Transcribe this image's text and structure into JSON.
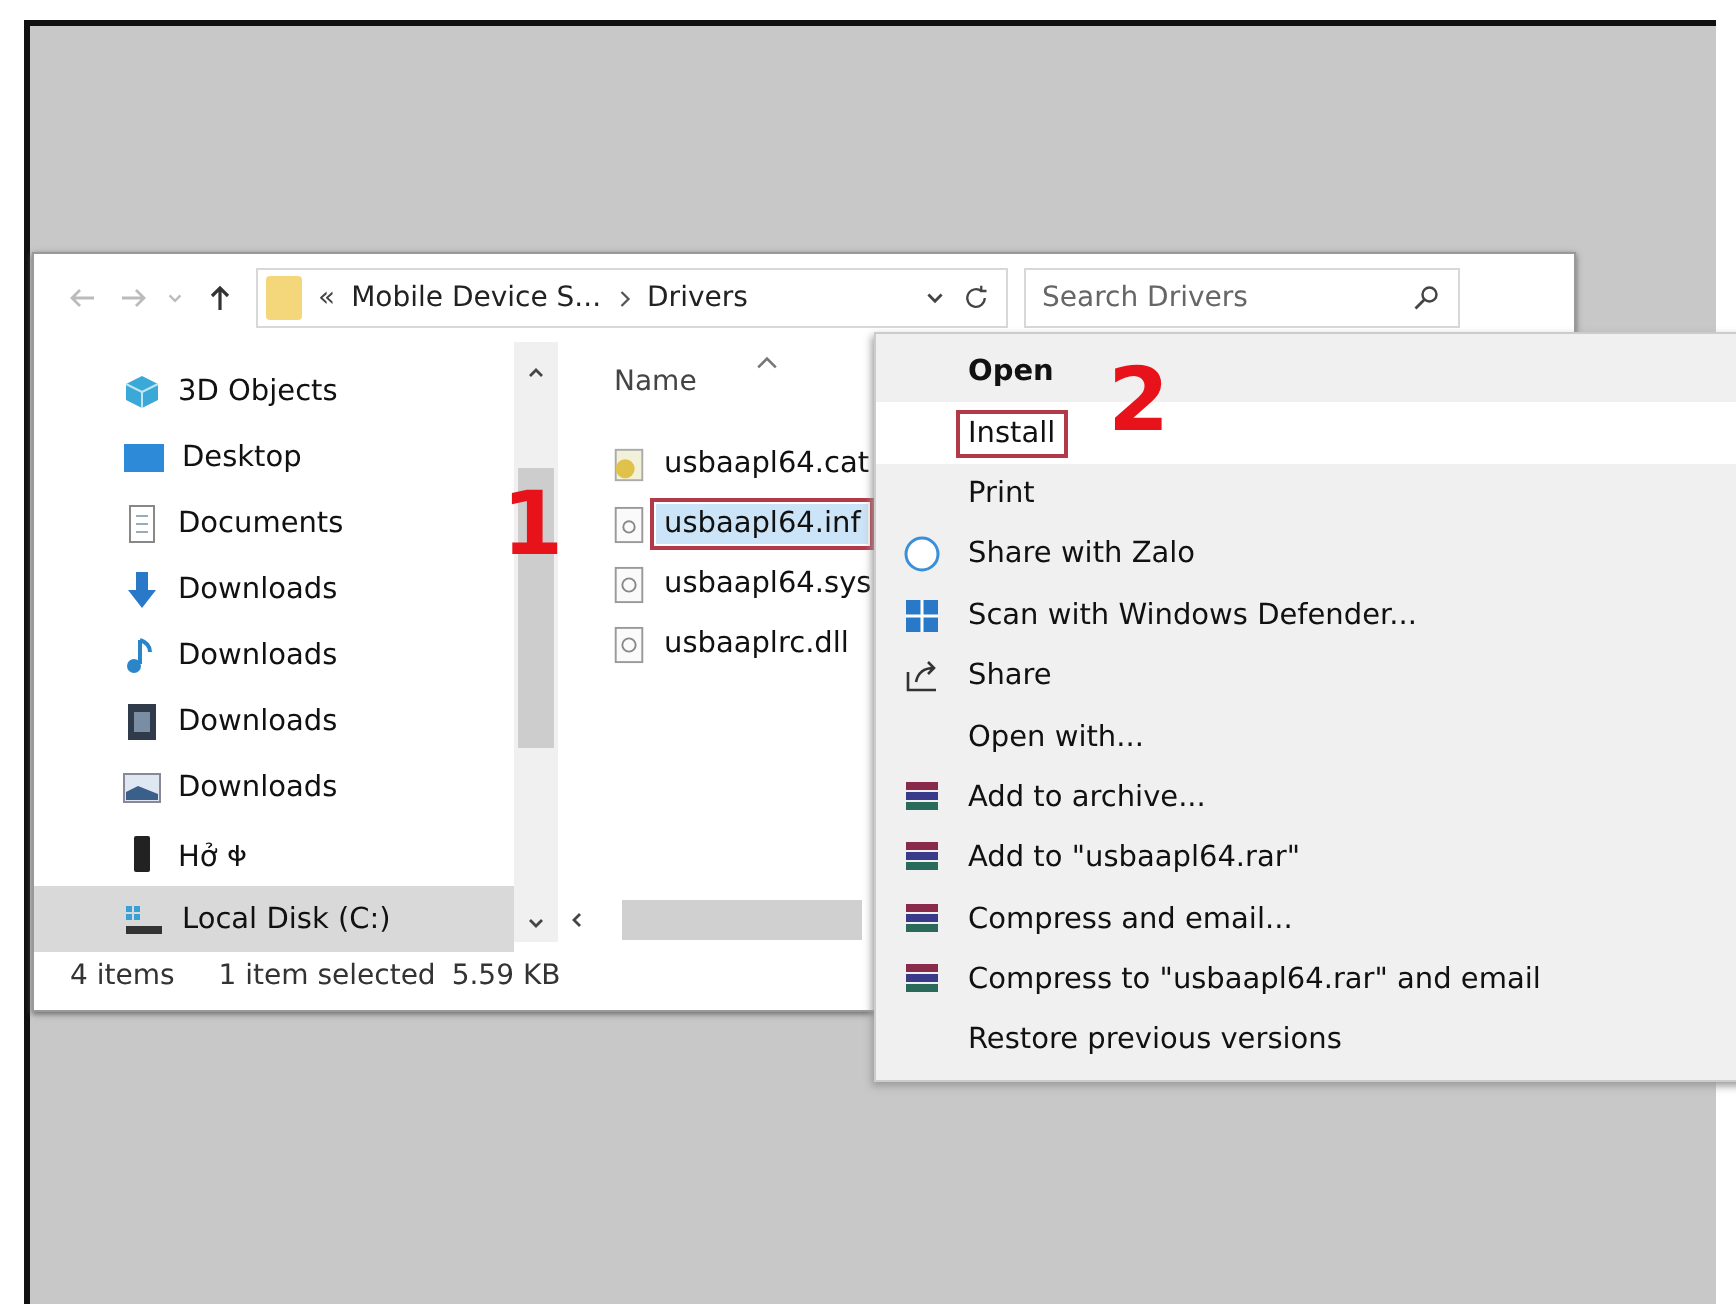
{
  "address_bar": {
    "overflow": "«",
    "segments": [
      "Mobile Device S...",
      "Drivers"
    ]
  },
  "search": {
    "placeholder": "Search Drivers"
  },
  "sidebar": {
    "items": [
      {
        "label": "3D Objects",
        "kind": "cube",
        "selected": false
      },
      {
        "label": "Desktop",
        "kind": "desktop",
        "selected": false
      },
      {
        "label": "Documents",
        "kind": "document",
        "selected": false
      },
      {
        "label": "Downloads",
        "kind": "download",
        "selected": false
      },
      {
        "label": "Downloads",
        "kind": "music",
        "selected": false
      },
      {
        "label": "Downloads",
        "kind": "video",
        "selected": false
      },
      {
        "label": "Downloads",
        "kind": "picture",
        "selected": false
      },
      {
        "label": "Hở 𐐡",
        "kind": "phone",
        "selected": false
      },
      {
        "label": "Local Disk (C:)",
        "kind": "disk",
        "selected": true
      }
    ]
  },
  "files": {
    "column": "Name",
    "items": [
      {
        "name": "usbaapl64.cat",
        "kind": "catalog",
        "selected": false
      },
      {
        "name": "usbaapl64.inf",
        "kind": "setup",
        "selected": true,
        "callout": "1"
      },
      {
        "name": "usbaapl64.sys",
        "kind": "system",
        "selected": false
      },
      {
        "name": "usbaaplrc.dll",
        "kind": "system",
        "selected": false
      }
    ]
  },
  "status_bar": {
    "count": "4 items",
    "selection": "1 item selected",
    "size": "5.59 KB"
  },
  "context_menu": {
    "items": [
      {
        "label": "Open",
        "kind": "default",
        "selected": false
      },
      {
        "label": "Install",
        "kind": "plain",
        "selected": true,
        "callout": "2"
      },
      {
        "label": "Print",
        "kind": "plain",
        "selected": false
      },
      {
        "label": "Share with Zalo",
        "kind": "zalo",
        "selected": false
      },
      {
        "label": "Scan with Windows Defender...",
        "kind": "defender",
        "selected": false
      },
      {
        "label": "Share",
        "kind": "share",
        "selected": false
      },
      {
        "label": "Open with...",
        "kind": "plain",
        "selected": false
      },
      {
        "label": "Add to archive...",
        "kind": "archive",
        "selected": false
      },
      {
        "label": "Add to \"usbaapl64.rar\"",
        "kind": "archive",
        "selected": false
      },
      {
        "label": "Compress and email...",
        "kind": "archive",
        "selected": false
      },
      {
        "label": "Compress to \"usbaapl64.rar\" and email",
        "kind": "archive",
        "selected": false
      },
      {
        "label": "Restore previous versions",
        "kind": "plain",
        "selected": false
      }
    ]
  }
}
